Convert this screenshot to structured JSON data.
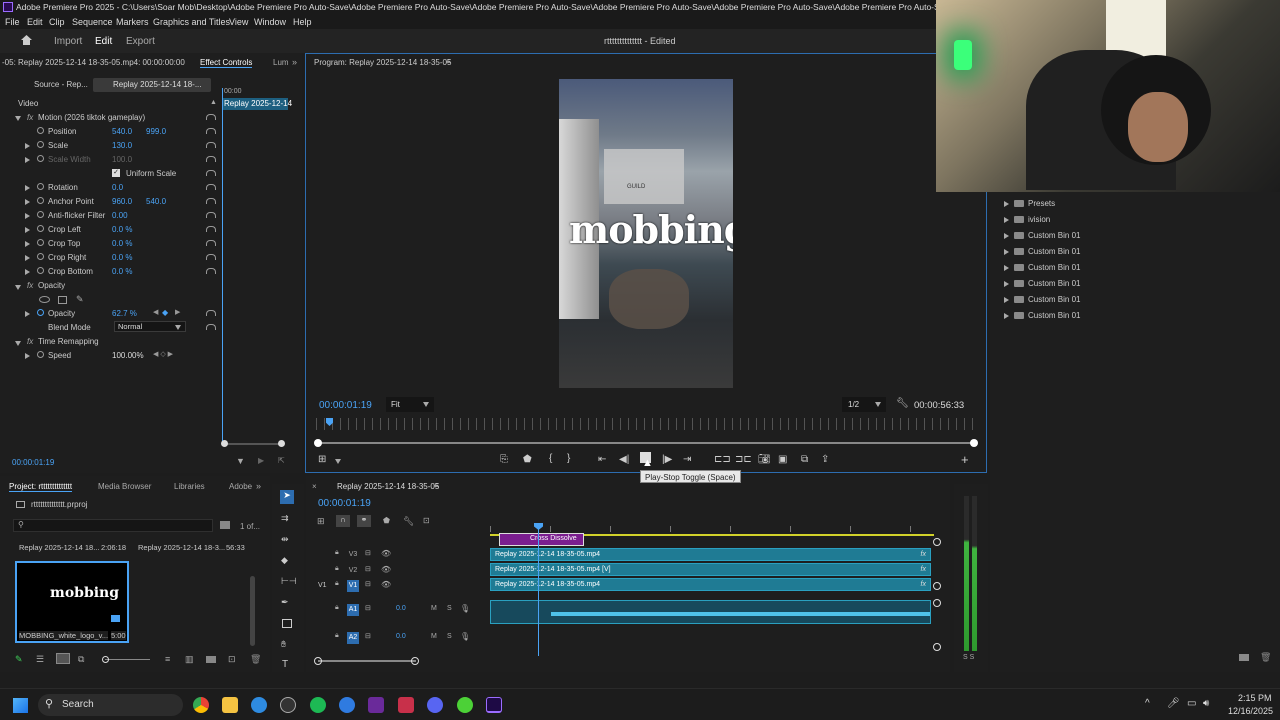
{
  "window": {
    "title": "Adobe Premiere Pro 2025 - C:\\Users\\Soar Mob\\Desktop\\Adobe Premiere Pro Auto-Save\\Adobe Premiere Pro Auto-Save\\Adobe Premiere Pro Auto-Save\\Adobe Premiere Pro Auto-Save\\Adobe Premiere Pro Auto-Save\\Adobe Premiere Pro Auto-Save\\Adobe Premiere Pro Auto-Save\\Adobe"
  },
  "menu": [
    "File",
    "Edit",
    "Clip",
    "Sequence",
    "Markers",
    "Graphics and Titles",
    "View",
    "Window",
    "Help"
  ],
  "header": {
    "tabs": [
      "Import",
      "Edit",
      "Export"
    ],
    "project_title": "rtttttttttttttt - Edited"
  },
  "effect_controls": {
    "tab_source": "Source - Rep...",
    "tab_replay": "Replay 2025-12-14 18-...",
    "tab_label": "Effect Controls",
    "tab_lum": "Lum",
    "clip_header": "-05: Replay 2025-12-14 18-35-05.mp4: 00:00:00:00",
    "mini_time": "00:00",
    "mini_clip": "Replay 2025-12-14",
    "video_label": "Video",
    "motion": "Motion (2026 tiktok gameplay)",
    "rows": [
      {
        "label": "Position",
        "v1": "540.0",
        "v2": "999.0"
      },
      {
        "label": "Scale",
        "v1": "130.0",
        "v2": ""
      },
      {
        "label": "Scale Width",
        "v1": "100.0",
        "v2": ""
      },
      {
        "label": "Uniform Scale",
        "v1": "",
        "v2": ""
      },
      {
        "label": "Rotation",
        "v1": "0.0",
        "v2": ""
      },
      {
        "label": "Anchor Point",
        "v1": "960.0",
        "v2": "540.0"
      },
      {
        "label": "Anti-flicker Filter",
        "v1": "0.00",
        "v2": ""
      },
      {
        "label": "Crop Left",
        "v1": "0.0 %",
        "v2": ""
      },
      {
        "label": "Crop Top",
        "v1": "0.0 %",
        "v2": ""
      },
      {
        "label": "Crop Right",
        "v1": "0.0 %",
        "v2": ""
      },
      {
        "label": "Crop Bottom",
        "v1": "0.0 %",
        "v2": ""
      }
    ],
    "opacity_group": "Opacity",
    "opacity_label": "Opacity",
    "opacity_value": "62.7 %",
    "blend_label": "Blend Mode",
    "blend_value": "Normal",
    "time_remap": "Time Remapping",
    "speed_label": "Speed",
    "speed_value": "100.00%",
    "timecode": "00:00:01:19"
  },
  "program": {
    "title": "Program: Replay 2025-12-14 18-35-05",
    "timecode": "00:00:01:19",
    "fit": "Fit",
    "res": "1/2",
    "duration": "00:00:56:33",
    "overlay_text": "mobbing",
    "tooltip": "Play-Stop Toggle (Space)",
    "guild": "GUILD"
  },
  "project": {
    "tab_project": "Project: rtttttttttttttt",
    "tab_media": "Media Browser",
    "tab_libs": "Libraries",
    "tab_adobe": "Adobe",
    "file": "rtttttttttttttt.prproj",
    "count": "1 of...",
    "items": [
      {
        "name": "Replay 2025-12-14 18...",
        "dur": "2:06:18"
      },
      {
        "name": "Replay 2025-12-14 18-3...",
        "dur": "56:33"
      }
    ],
    "logo_item": {
      "name": "MOBBING_white_logo_v...",
      "dur": "5:00",
      "logo_text": "mobbing"
    }
  },
  "bins": [
    "Presets",
    "ivision",
    "Custom Bin 01",
    "Custom Bin 01",
    "Custom Bin 01",
    "Custom Bin 01",
    "Custom Bin 01",
    "Custom Bin 01"
  ],
  "timeline": {
    "tab": "Replay 2025-12-14 18-35-05",
    "timecode": "00:00:01:19",
    "transition": "Cross Dissolve",
    "clips": [
      "Replay 2025-12-14 18-35-05.mp4",
      "Replay 2025-12-14 18-35-05.mp4 [V]",
      "Replay 2025-12-14 18-35-05.mp4"
    ],
    "tracks": [
      {
        "name": "V3",
        "vol": ""
      },
      {
        "name": "V2",
        "vol": ""
      },
      {
        "name": "V1",
        "vol": ""
      },
      {
        "name": "A1",
        "vol": "0.0"
      },
      {
        "name": "A2",
        "vol": "0.0"
      }
    ],
    "v1_left": "V1",
    "solo": "S",
    "meter_labels": "S S"
  },
  "taskbar": {
    "search": "Search",
    "time": "2:15 PM",
    "date": "12/16/2025"
  }
}
